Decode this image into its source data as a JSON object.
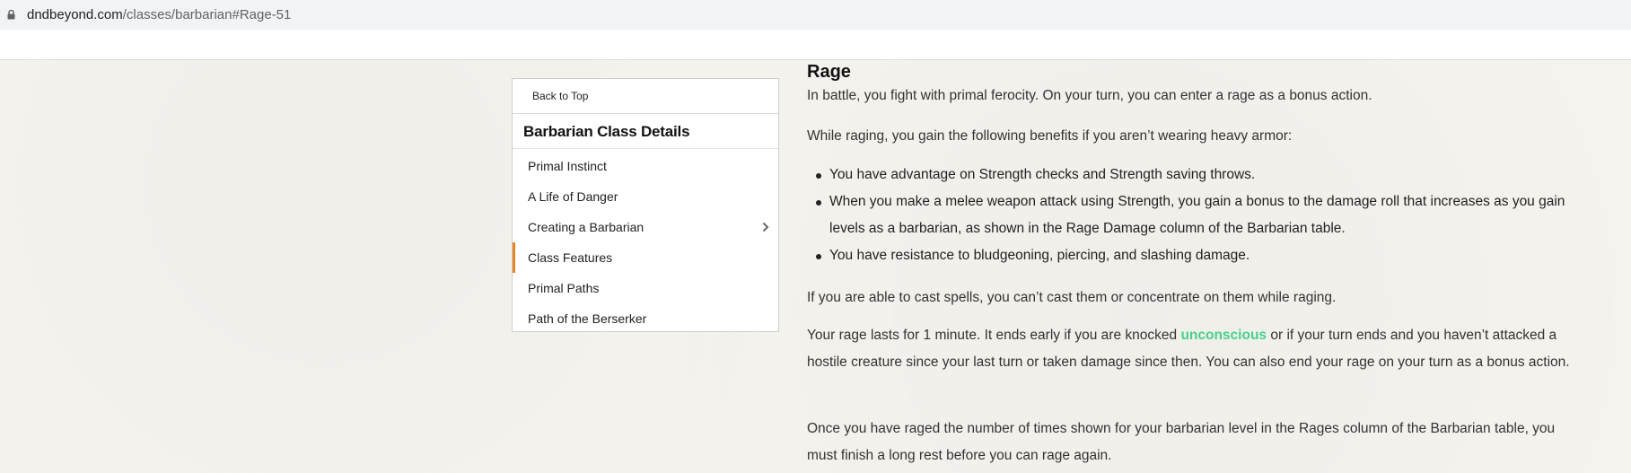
{
  "browser": {
    "url_host": "dndbeyond.com",
    "url_path": "/classes/barbarian#Rage-51"
  },
  "sidebar": {
    "back_to_top": "Back to Top",
    "title": "Barbarian Class Details",
    "items": [
      {
        "label": "Primal Instinct"
      },
      {
        "label": "A Life of Danger"
      },
      {
        "label": "Creating a Barbarian"
      },
      {
        "label": "Class Features"
      },
      {
        "label": "Primal Paths"
      },
      {
        "label": "Path of the Berserker"
      }
    ],
    "accent_color": "#e6852a"
  },
  "content": {
    "heading": "Rage",
    "p1": "In battle, you fight with primal ferocity. On your turn, you can enter a rage as a bonus action.",
    "p2": "While raging, you gain the following benefits if you aren’t wearing heavy armor:",
    "bullets": [
      "You have advantage on Strength checks and Strength saving throws.",
      "When you make a melee weapon attack using Strength, you gain a bonus to the damage roll that increases as you gain levels as a barbarian, as shown in the Rage Damage column of the Barbarian table.",
      "You have resistance to bludgeoning, piercing, and slashing damage."
    ],
    "p3": "If you are able to cast spells, you can’t cast them or concentrate on them while raging.",
    "p4_before": "Your rage lasts for 1 minute. It ends early if you are knocked ",
    "p4_link": "unconscious",
    "p4_after": " or if your turn ends and you haven’t attacked a hostile creature since your last turn or taken damage since then. You can also end your rage on your turn as a bonus action.",
    "p5": "Once you have raged the number of times shown for your barbarian level in the Rages column of the Barbarian table, you must finish a long rest before you can rage again.",
    "link_color": "#47d18c"
  }
}
